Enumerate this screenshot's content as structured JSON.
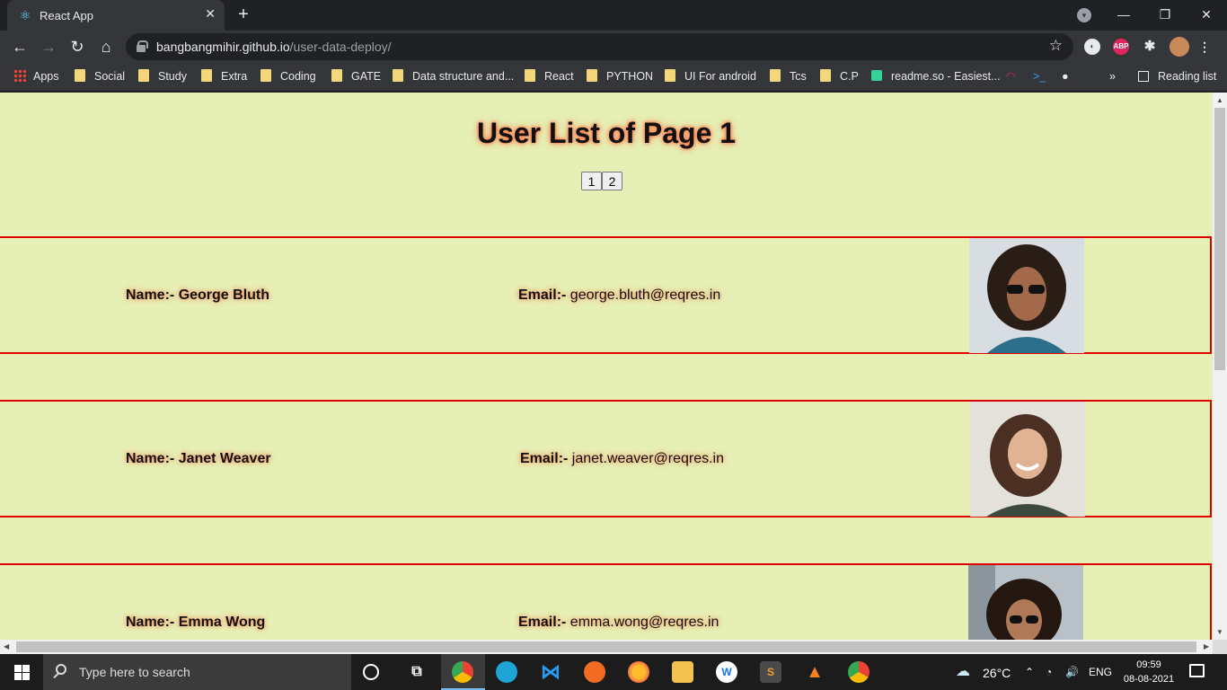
{
  "browser": {
    "tab_title": "React App",
    "tab_close": "✕",
    "new_tab": "+",
    "url_host": "bangbangmihir.github.io",
    "url_path": "/user-data-deploy/",
    "win_min": "—",
    "win_restore": "❐",
    "win_close": "✕",
    "bookmarks": [
      "Apps",
      "Social",
      "Study",
      "Extra",
      "Coding",
      "GATE",
      "Data structure and...",
      "React",
      "PYTHON",
      "UI For android",
      "Tcs",
      "C.P",
      "readme.so - Easiest..."
    ],
    "bookmarks_more": "»",
    "reading_list": "Reading list"
  },
  "page": {
    "title": "User List of Page 1",
    "pages": [
      "1",
      "2"
    ],
    "name_label": "Name:- ",
    "email_label": "Email:- ",
    "users": [
      {
        "name": "George Bluth",
        "email": "george.bluth@reqres.in"
      },
      {
        "name": "Janet Weaver",
        "email": "janet.weaver@reqres.in"
      },
      {
        "name": "Emma Wong",
        "email": "emma.wong@reqres.in"
      }
    ]
  },
  "taskbar": {
    "search_placeholder": "Type here to search",
    "weather": "26°C",
    "language": "ENG",
    "time": "09:59",
    "date": "08-08-2021"
  },
  "colors": {
    "page_bg": "#e6efb5",
    "card_border": "#e00000",
    "text_glow": "#ff6a3d"
  }
}
